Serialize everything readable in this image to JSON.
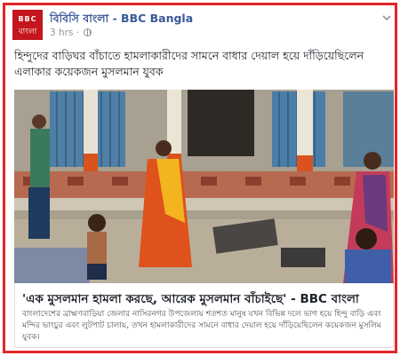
{
  "post": {
    "logo_top": "BBC",
    "logo_bottom": "বাংলা",
    "page_name": "বিবিসি বাংলা - BBC Bangla",
    "time": "3 hrs ·",
    "text": "হিন্দুদের বাড়িঘর বাঁচাতে হামলাকারীদের সামনে বাধার দেয়াল হয়ে দাঁড়িয়েছিলেন এলাকার কয়েকজন মুসলমান যুবক"
  },
  "link": {
    "title": "'এক মুসলমান হামলা করছে, আরেক মুসলমান বাঁচাইছে' - BBC বাংলা",
    "description": "বাংলাদেশের ব্রাহ্মণবাড়িয়া জেলার নাসিরনগর উপজেলায় শতশত মানুষ যখন বিভিন্ন দলে ভাগ হয়ে হিন্দু বাড়ি এবং মন্দির ভাংচুর এবং লুটপাট চালায়, তখন হামলাকারীদের সামনে বাধার দেয়াল হয়ে দাঁড়িয়েছিলেন কয়েকজন মুসলিম যুবক।"
  },
  "colors": {
    "frame": "#e4262a",
    "logo": "#c4161c",
    "page_name": "#3b5998"
  },
  "icons": {
    "options": "chevron-down-icon",
    "audience": "globe-icon"
  }
}
